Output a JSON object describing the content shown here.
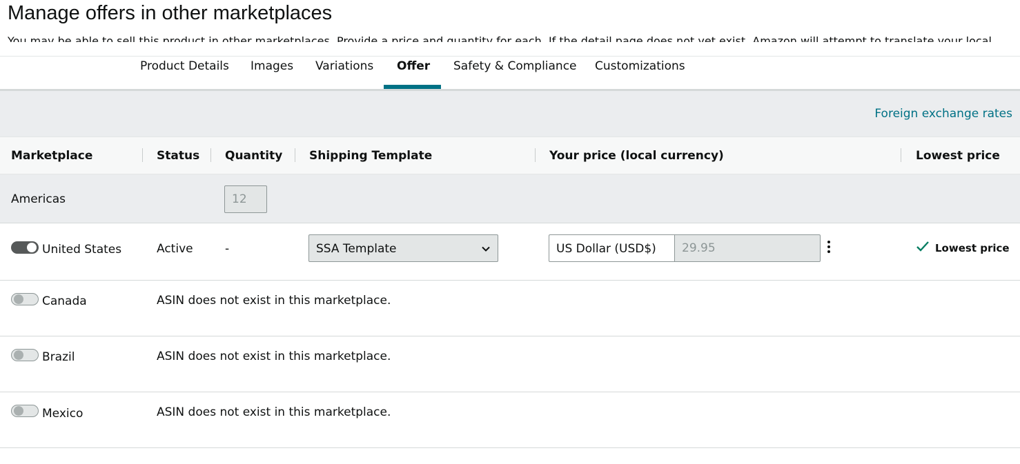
{
  "page": {
    "title": "Manage offers in other marketplaces",
    "subtitle": "You may be able to sell this product in other marketplaces. Provide a price and quantity for each. If the detail page does not yet exist, Amazon will attempt to translate your local"
  },
  "tabs": [
    {
      "label": "Product Details"
    },
    {
      "label": "Images"
    },
    {
      "label": "Variations"
    },
    {
      "label": "Offer",
      "active": true
    },
    {
      "label": "Safety & Compliance"
    },
    {
      "label": "Customizations"
    }
  ],
  "banner": {
    "link": "Foreign exchange rates"
  },
  "table": {
    "headers": {
      "marketplace": "Marketplace",
      "status": "Status",
      "quantity": "Quantity",
      "shipping": "Shipping Template",
      "price": "Your price (local currency)",
      "lowest": "Lowest price"
    },
    "region": {
      "name": "Americas",
      "quantity": "12"
    },
    "rows": [
      {
        "name": "United States",
        "enabled": true,
        "status": "Active",
        "quantity": "-",
        "shipping_template": "SSA Template",
        "currency": "US Dollar (USD$)",
        "price": "29.95",
        "lowest_price": "Lowest price"
      },
      {
        "name": "Canada",
        "enabled": false,
        "message": "ASIN does not exist in this marketplace."
      },
      {
        "name": "Brazil",
        "enabled": false,
        "message": "ASIN does not exist in this marketplace."
      },
      {
        "name": "Mexico",
        "enabled": false,
        "message": "ASIN does not exist in this marketplace."
      }
    ]
  },
  "colors": {
    "accent": "#007185",
    "banner_bg": "#ebedef",
    "check": "#067d62"
  },
  "icons": {
    "chevron": "chevron-down-icon",
    "more": "kebab-menu-icon",
    "check": "check-icon"
  }
}
